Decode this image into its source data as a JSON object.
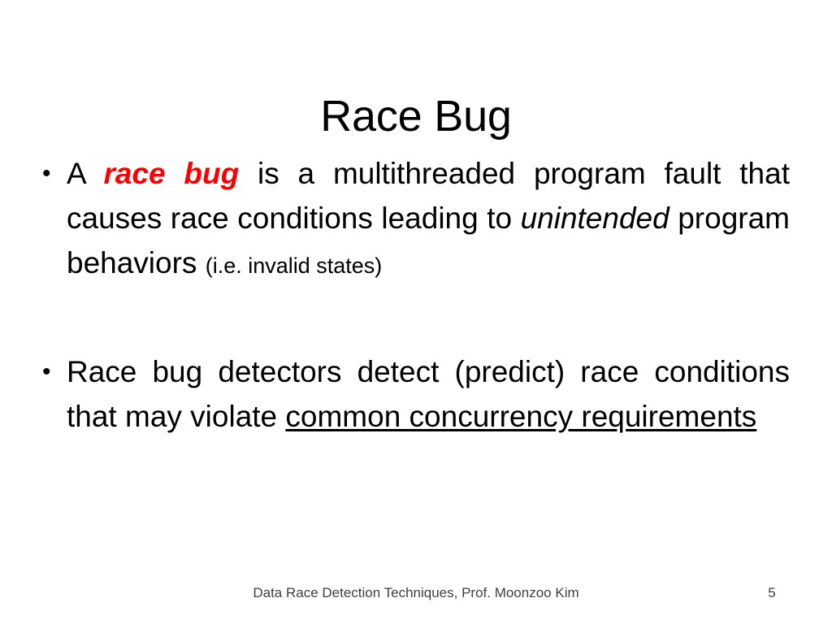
{
  "slide": {
    "title": "Race Bug",
    "bullets": [
      {
        "id": "bullet-race-bug-definition",
        "runs": [
          {
            "text": "A ",
            "style": "normal"
          },
          {
            "text": "race bug",
            "style": "bold-italic-red"
          },
          {
            "text": " is a multithreaded program fault that causes race conditions leading to ",
            "style": "normal"
          },
          {
            "text": "unintended",
            "style": "italic"
          },
          {
            "text": " program behaviors ",
            "style": "normal"
          },
          {
            "text": "(i.e. invalid states)",
            "style": "small"
          }
        ]
      },
      {
        "id": "bullet-race-bug-detectors",
        "runs": [
          {
            "text": "Race bug detectors detect (predict) race conditions that may violate ",
            "style": "normal"
          },
          {
            "text": "common concurrency requirements",
            "style": "underline"
          }
        ]
      }
    ],
    "footer": {
      "text": "Data Race Detection Techniques, Prof. Moonzoo Kim",
      "slide_number": "5"
    },
    "colors": {
      "accent_red": "#ff0000",
      "text": "#000000",
      "footer_text": "#3f3f3f",
      "background": "#ffffff"
    }
  }
}
